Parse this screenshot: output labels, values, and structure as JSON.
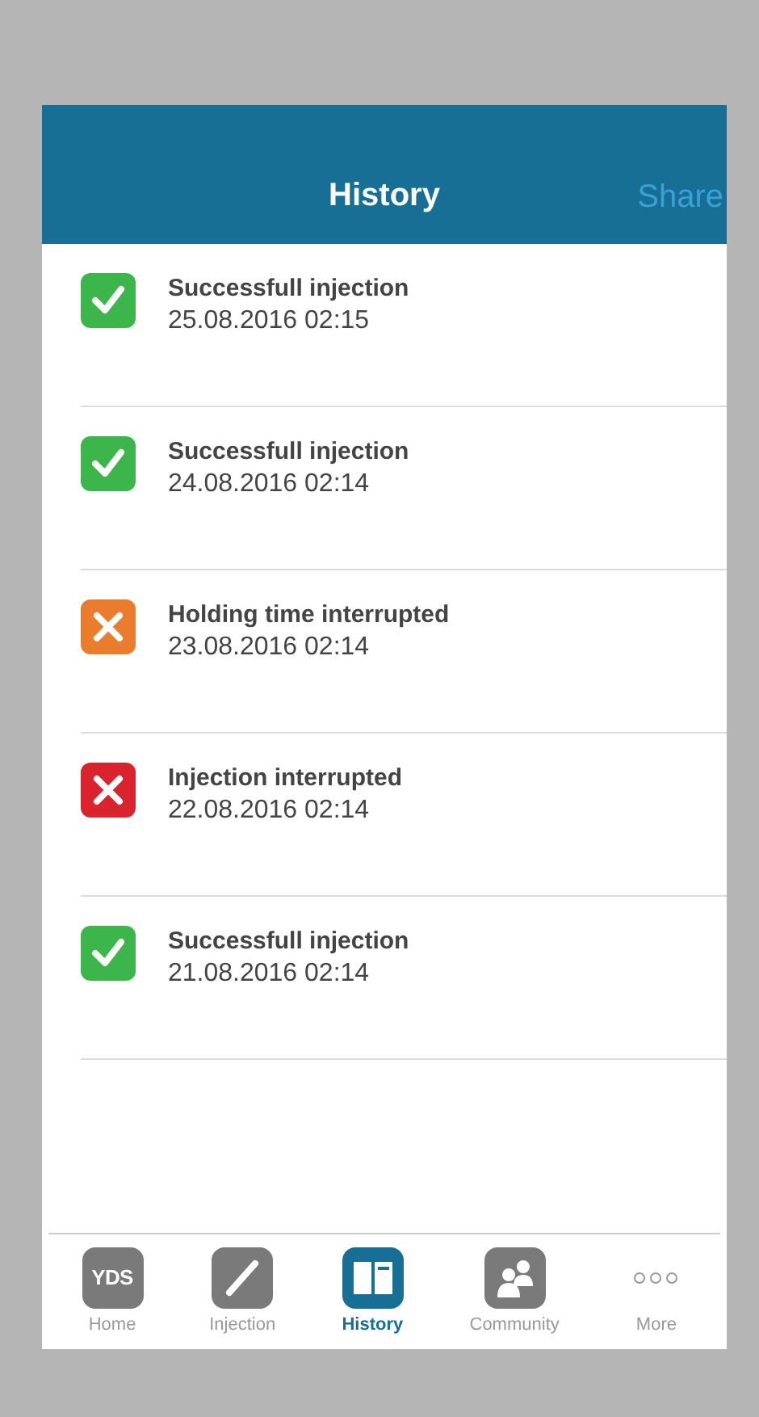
{
  "header": {
    "title": "History",
    "action": "Share"
  },
  "entries": [
    {
      "title": "Successfull injection",
      "time": "25.08.2016 02:15",
      "kind": "success"
    },
    {
      "title": "Successfull injection",
      "time": "24.08.2016 02:14",
      "kind": "success"
    },
    {
      "title": "Holding time interrupted",
      "time": "23.08.2016 02:14",
      "kind": "warning"
    },
    {
      "title": "Injection interrupted",
      "time": "22.08.2016 02:14",
      "kind": "error"
    },
    {
      "title": "Successfull injection",
      "time": "21.08.2016 02:14",
      "kind": "success"
    }
  ],
  "tabs": [
    {
      "label": "Home",
      "kind": "logo",
      "logo_text": "YDS",
      "selected": false
    },
    {
      "label": "Injection",
      "kind": "pen",
      "selected": false
    },
    {
      "label": "History",
      "kind": "book",
      "selected": true
    },
    {
      "label": "Community",
      "kind": "people",
      "selected": false
    },
    {
      "label": "More",
      "kind": "dots",
      "selected": false
    }
  ]
}
